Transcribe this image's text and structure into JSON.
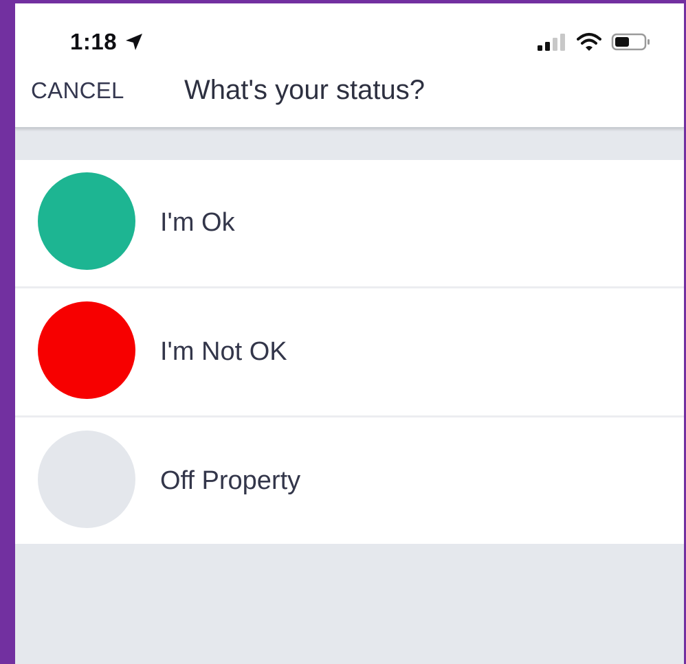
{
  "status_bar": {
    "time": "1:18",
    "icons": [
      "location-arrow-icon",
      "signal-bars-icon",
      "wifi-icon",
      "battery-icon"
    ]
  },
  "header": {
    "cancel_label": "CANCEL",
    "title": "What's your status?"
  },
  "statuses": [
    {
      "label": "I'm Ok",
      "color": "#1DB592"
    },
    {
      "label": "I'm Not OK",
      "color": "#F70000"
    },
    {
      "label": "Off Property",
      "color": "#E4E7EC"
    }
  ],
  "colors": {
    "frame": "#7230A0",
    "background": "#E5E8ED",
    "text": "#33364A"
  }
}
